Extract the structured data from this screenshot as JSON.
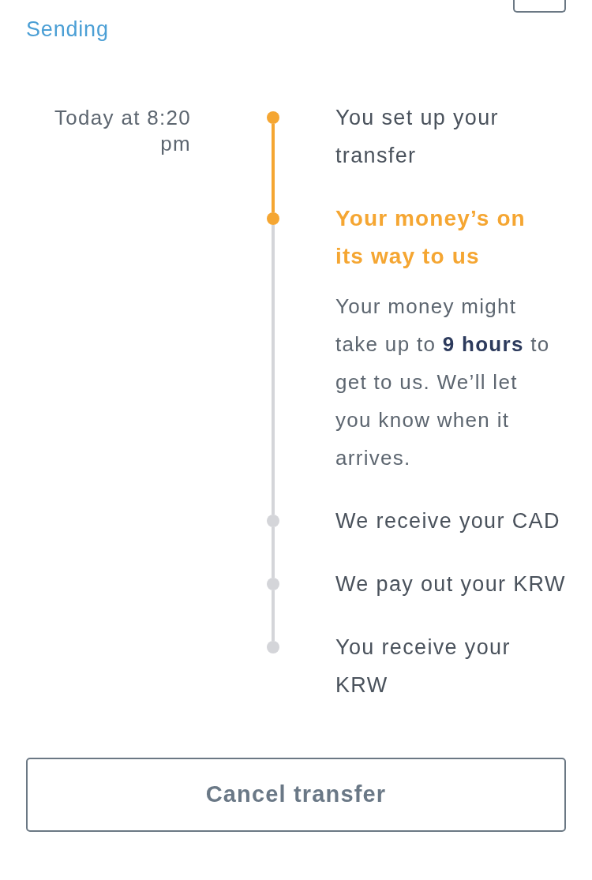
{
  "status_label": "Sending",
  "timeline": {
    "steps": [
      {
        "time": "Today at 8:20 pm",
        "label": "You set up your transfer",
        "completed": true,
        "active": false
      },
      {
        "label": "Your money’s on its way to us",
        "completed": false,
        "active": true,
        "description": "Your money might take up to **9 hours** to get to us. We’ll let you know when it arrives."
      },
      {
        "label": "We receive your CAD",
        "completed": false,
        "active": false
      },
      {
        "label": "We pay out your KRW",
        "completed": false,
        "active": false
      },
      {
        "label": "You receive your KRW",
        "completed": false,
        "active": false
      }
    ]
  },
  "cancel_button": {
    "label": "Cancel transfer"
  }
}
